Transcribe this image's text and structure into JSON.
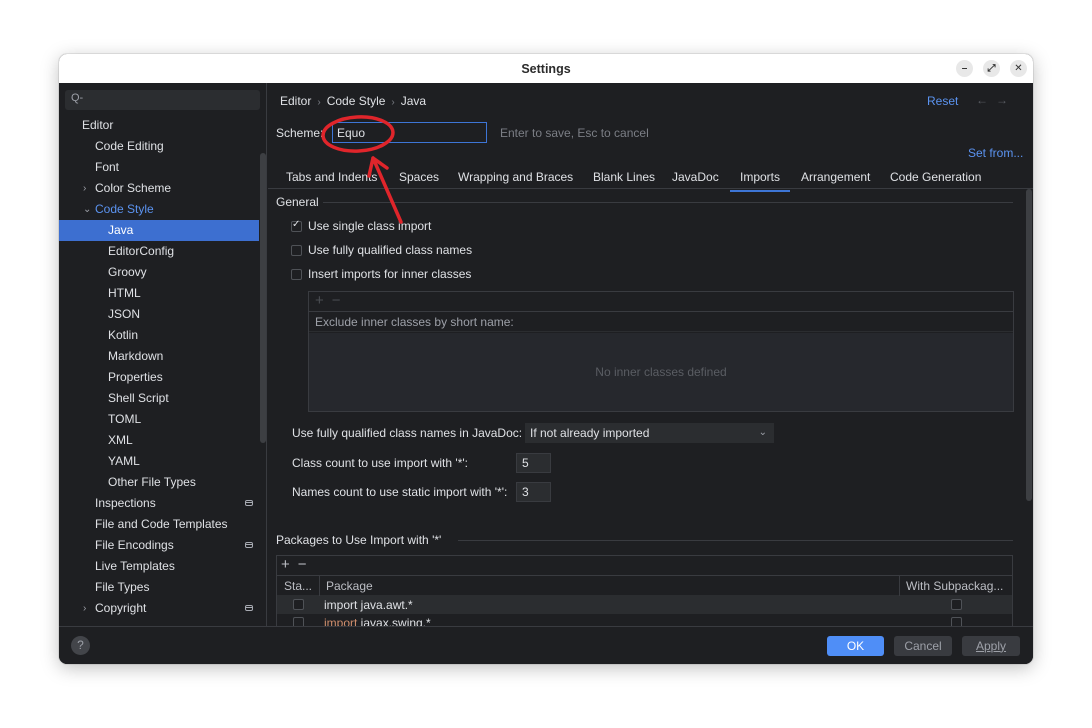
{
  "window": {
    "title": "Settings",
    "controls": [
      "minimize",
      "maximize",
      "close"
    ]
  },
  "sidebar": {
    "search_placeholder": "",
    "search_icon": "Q-",
    "items": [
      {
        "label": "Editor",
        "level": 0
      },
      {
        "label": "Code Editing",
        "level": 1
      },
      {
        "label": "Font",
        "level": 1
      },
      {
        "label": "Color Scheme",
        "level": 1,
        "chevron": "right"
      },
      {
        "label": "Code Style",
        "level": 1,
        "chevron": "down",
        "highlighted": true
      },
      {
        "label": "Java",
        "level": 2,
        "selected": true
      },
      {
        "label": "EditorConfig",
        "level": 2
      },
      {
        "label": "Groovy",
        "level": 2
      },
      {
        "label": "HTML",
        "level": 2
      },
      {
        "label": "JSON",
        "level": 2
      },
      {
        "label": "Kotlin",
        "level": 2
      },
      {
        "label": "Markdown",
        "level": 2
      },
      {
        "label": "Properties",
        "level": 2
      },
      {
        "label": "Shell Script",
        "level": 2
      },
      {
        "label": "TOML",
        "level": 2
      },
      {
        "label": "XML",
        "level": 2
      },
      {
        "label": "YAML",
        "level": 2
      },
      {
        "label": "Other File Types",
        "level": 2
      },
      {
        "label": "Inspections",
        "level": 1,
        "project_icon": true
      },
      {
        "label": "File and Code Templates",
        "level": 1
      },
      {
        "label": "File Encodings",
        "level": 1,
        "project_icon": true
      },
      {
        "label": "Live Templates",
        "level": 1
      },
      {
        "label": "File Types",
        "level": 1
      },
      {
        "label": "Copyright",
        "level": 1,
        "chevron": "right",
        "project_icon": true
      }
    ]
  },
  "header": {
    "breadcrumb": [
      "Editor",
      "Code Style",
      "Java"
    ],
    "reset_label": "Reset",
    "back_arrow": "←",
    "forward_arrow": "→"
  },
  "scheme": {
    "label": "Scheme:",
    "value": "Equo",
    "hint": "Enter to save, Esc to cancel",
    "set_from_label": "Set from..."
  },
  "tabs": [
    {
      "label": "Tabs and Indents"
    },
    {
      "label": "Spaces"
    },
    {
      "label": "Wrapping and Braces"
    },
    {
      "label": "Blank Lines"
    },
    {
      "label": "JavaDoc"
    },
    {
      "label": "Imports",
      "active": true
    },
    {
      "label": "Arrangement"
    },
    {
      "label": "Code Generation"
    }
  ],
  "general": {
    "title": "General",
    "options": [
      {
        "label": "Use single class import",
        "checked": true
      },
      {
        "label": "Use fully qualified class names",
        "checked": false
      },
      {
        "label": "Insert imports for inner classes",
        "checked": false
      }
    ],
    "inner_classes": {
      "add": "+",
      "remove": "−",
      "header": "Exclude inner classes by short name:",
      "empty_text": "No inner classes defined"
    },
    "javadoc_label": "Use fully qualified class names in JavaDoc:",
    "javadoc_value": "If not already imported",
    "class_count_label": "Class count to use import with '*':",
    "class_count_value": "5",
    "names_count_label": "Names count to use static import with '*':",
    "names_count_value": "3"
  },
  "packages": {
    "title": "Packages to Use Import with '*'",
    "add": "+",
    "remove": "−",
    "columns": [
      "Sta...",
      "Package",
      "With Subpackag..."
    ],
    "rows": [
      {
        "static": false,
        "keyword": "import",
        "package": " java.awt.*",
        "with_subpackages": false
      },
      {
        "static": false,
        "keyword": "import",
        "package": " javax.swing.*",
        "with_subpackages": false
      }
    ]
  },
  "footer": {
    "help": "?",
    "ok_label": "OK",
    "cancel_label": "Cancel",
    "apply_label": "Apply"
  },
  "colors": {
    "accent": "#3d75d6",
    "selection": "#3d6fd0",
    "link": "#5b93f0",
    "ok_button": "#4f8ef7",
    "background": "#1e1f22",
    "annotation_red": "#e0252b",
    "keyword": "#cf8e6d"
  }
}
